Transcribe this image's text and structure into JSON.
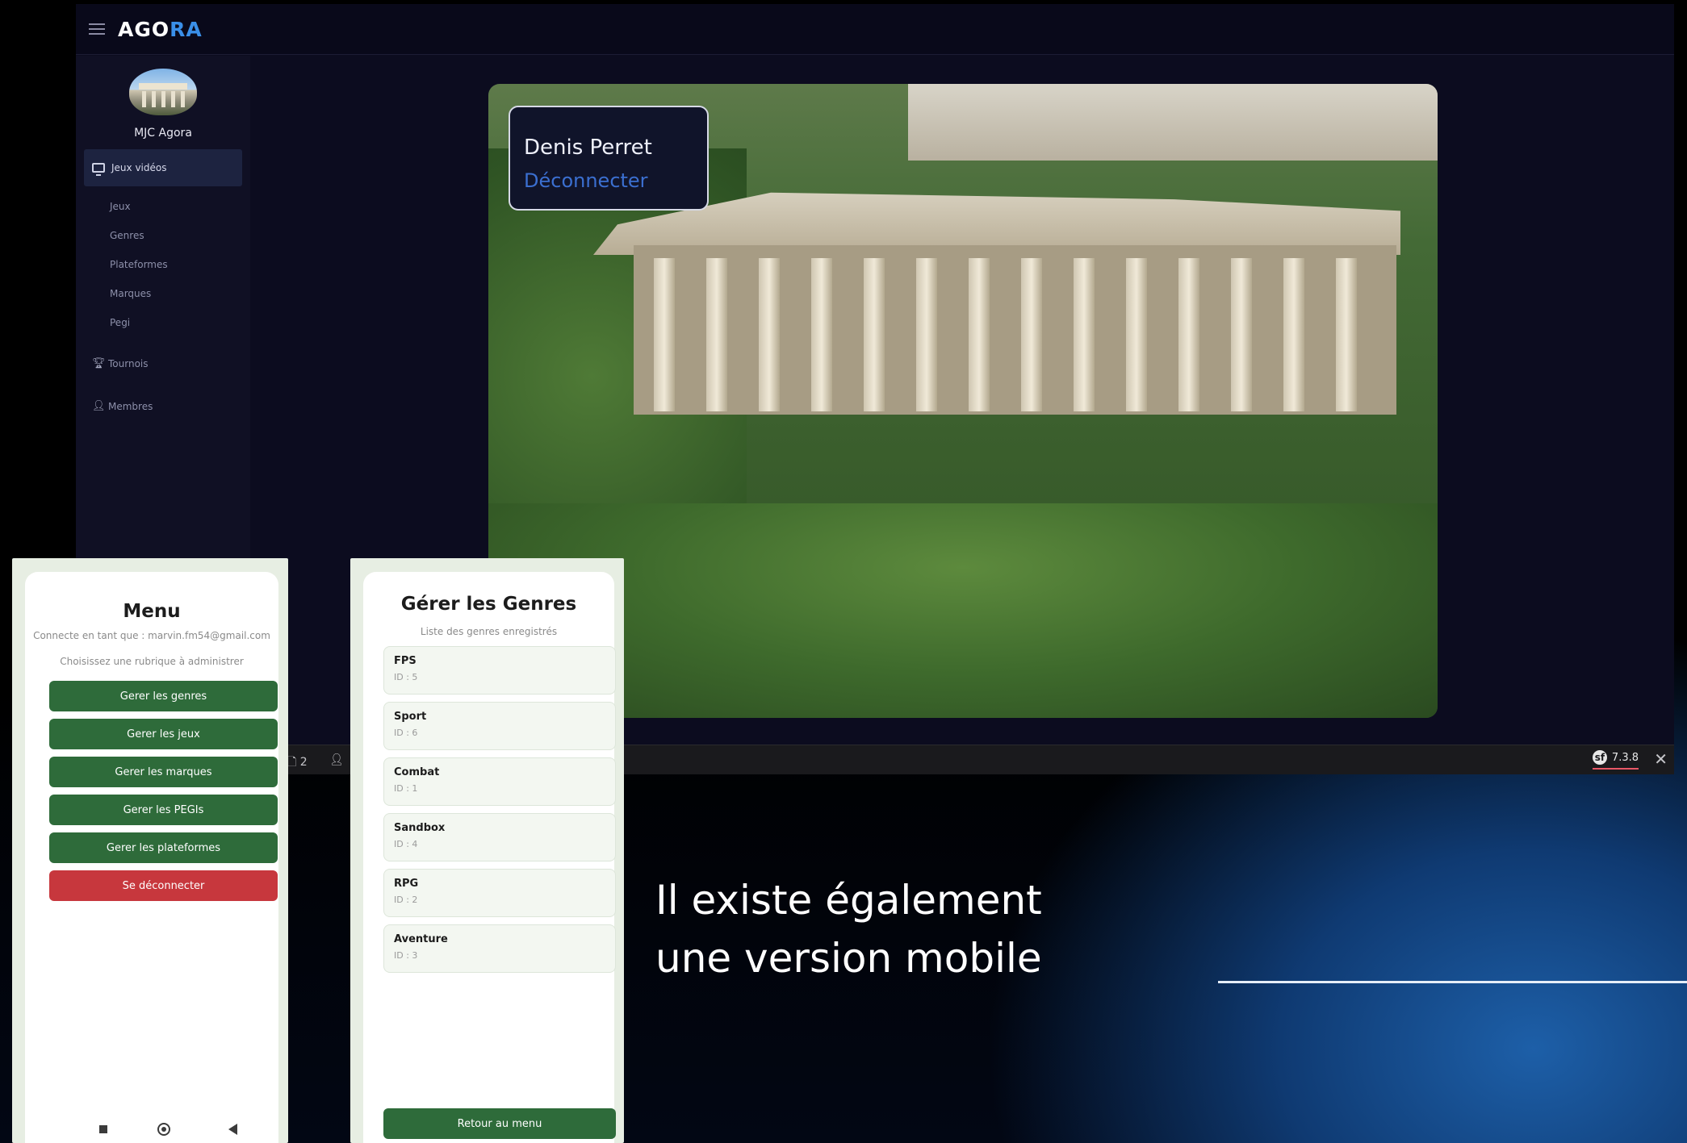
{
  "desktop": {
    "brand_part1": "AGO",
    "brand_part2": "RA",
    "org_name": "MJC Agora",
    "nav_main": "Jeux vidéos",
    "sub_items": [
      "Jeux",
      "Genres",
      "Plateformes",
      "Marques",
      "Pegi"
    ],
    "nav_tournois": "Tournois",
    "nav_membres": "Membres",
    "user_name": "Denis Perret",
    "logout": "Déconnecter",
    "debug": {
      "requests": "2",
      "symfony_version": "7.3.8"
    }
  },
  "mobile_menu": {
    "title": "Menu",
    "connected_as": "Connecte en tant que : marvin.fm54@gmail.com",
    "choose": "Choisissez une rubrique à administrer",
    "buttons": [
      "Gerer les genres",
      "Gerer les jeux",
      "Gerer les marques",
      "Gerer les PEGIs",
      "Gerer les plateformes"
    ],
    "logout": "Se déconnecter"
  },
  "mobile_genres": {
    "title": "Gérer les Genres",
    "subtitle": "Liste des genres enregistrés",
    "genres": [
      {
        "name": "FPS",
        "id": "ID : 5"
      },
      {
        "name": "Sport",
        "id": "ID : 6"
      },
      {
        "name": "Combat",
        "id": "ID : 1"
      },
      {
        "name": "Sandbox",
        "id": "ID : 4"
      },
      {
        "name": "RPG",
        "id": "ID : 2"
      },
      {
        "name": "Aventure",
        "id": "ID : 3"
      }
    ],
    "back_button": "Retour au menu"
  },
  "caption": {
    "line1": "Il existe également",
    "line2": "une version mobile"
  },
  "colors": {
    "accent_blue": "#3a8fe8",
    "green": "#2e6b3a",
    "red": "#c7373d"
  }
}
